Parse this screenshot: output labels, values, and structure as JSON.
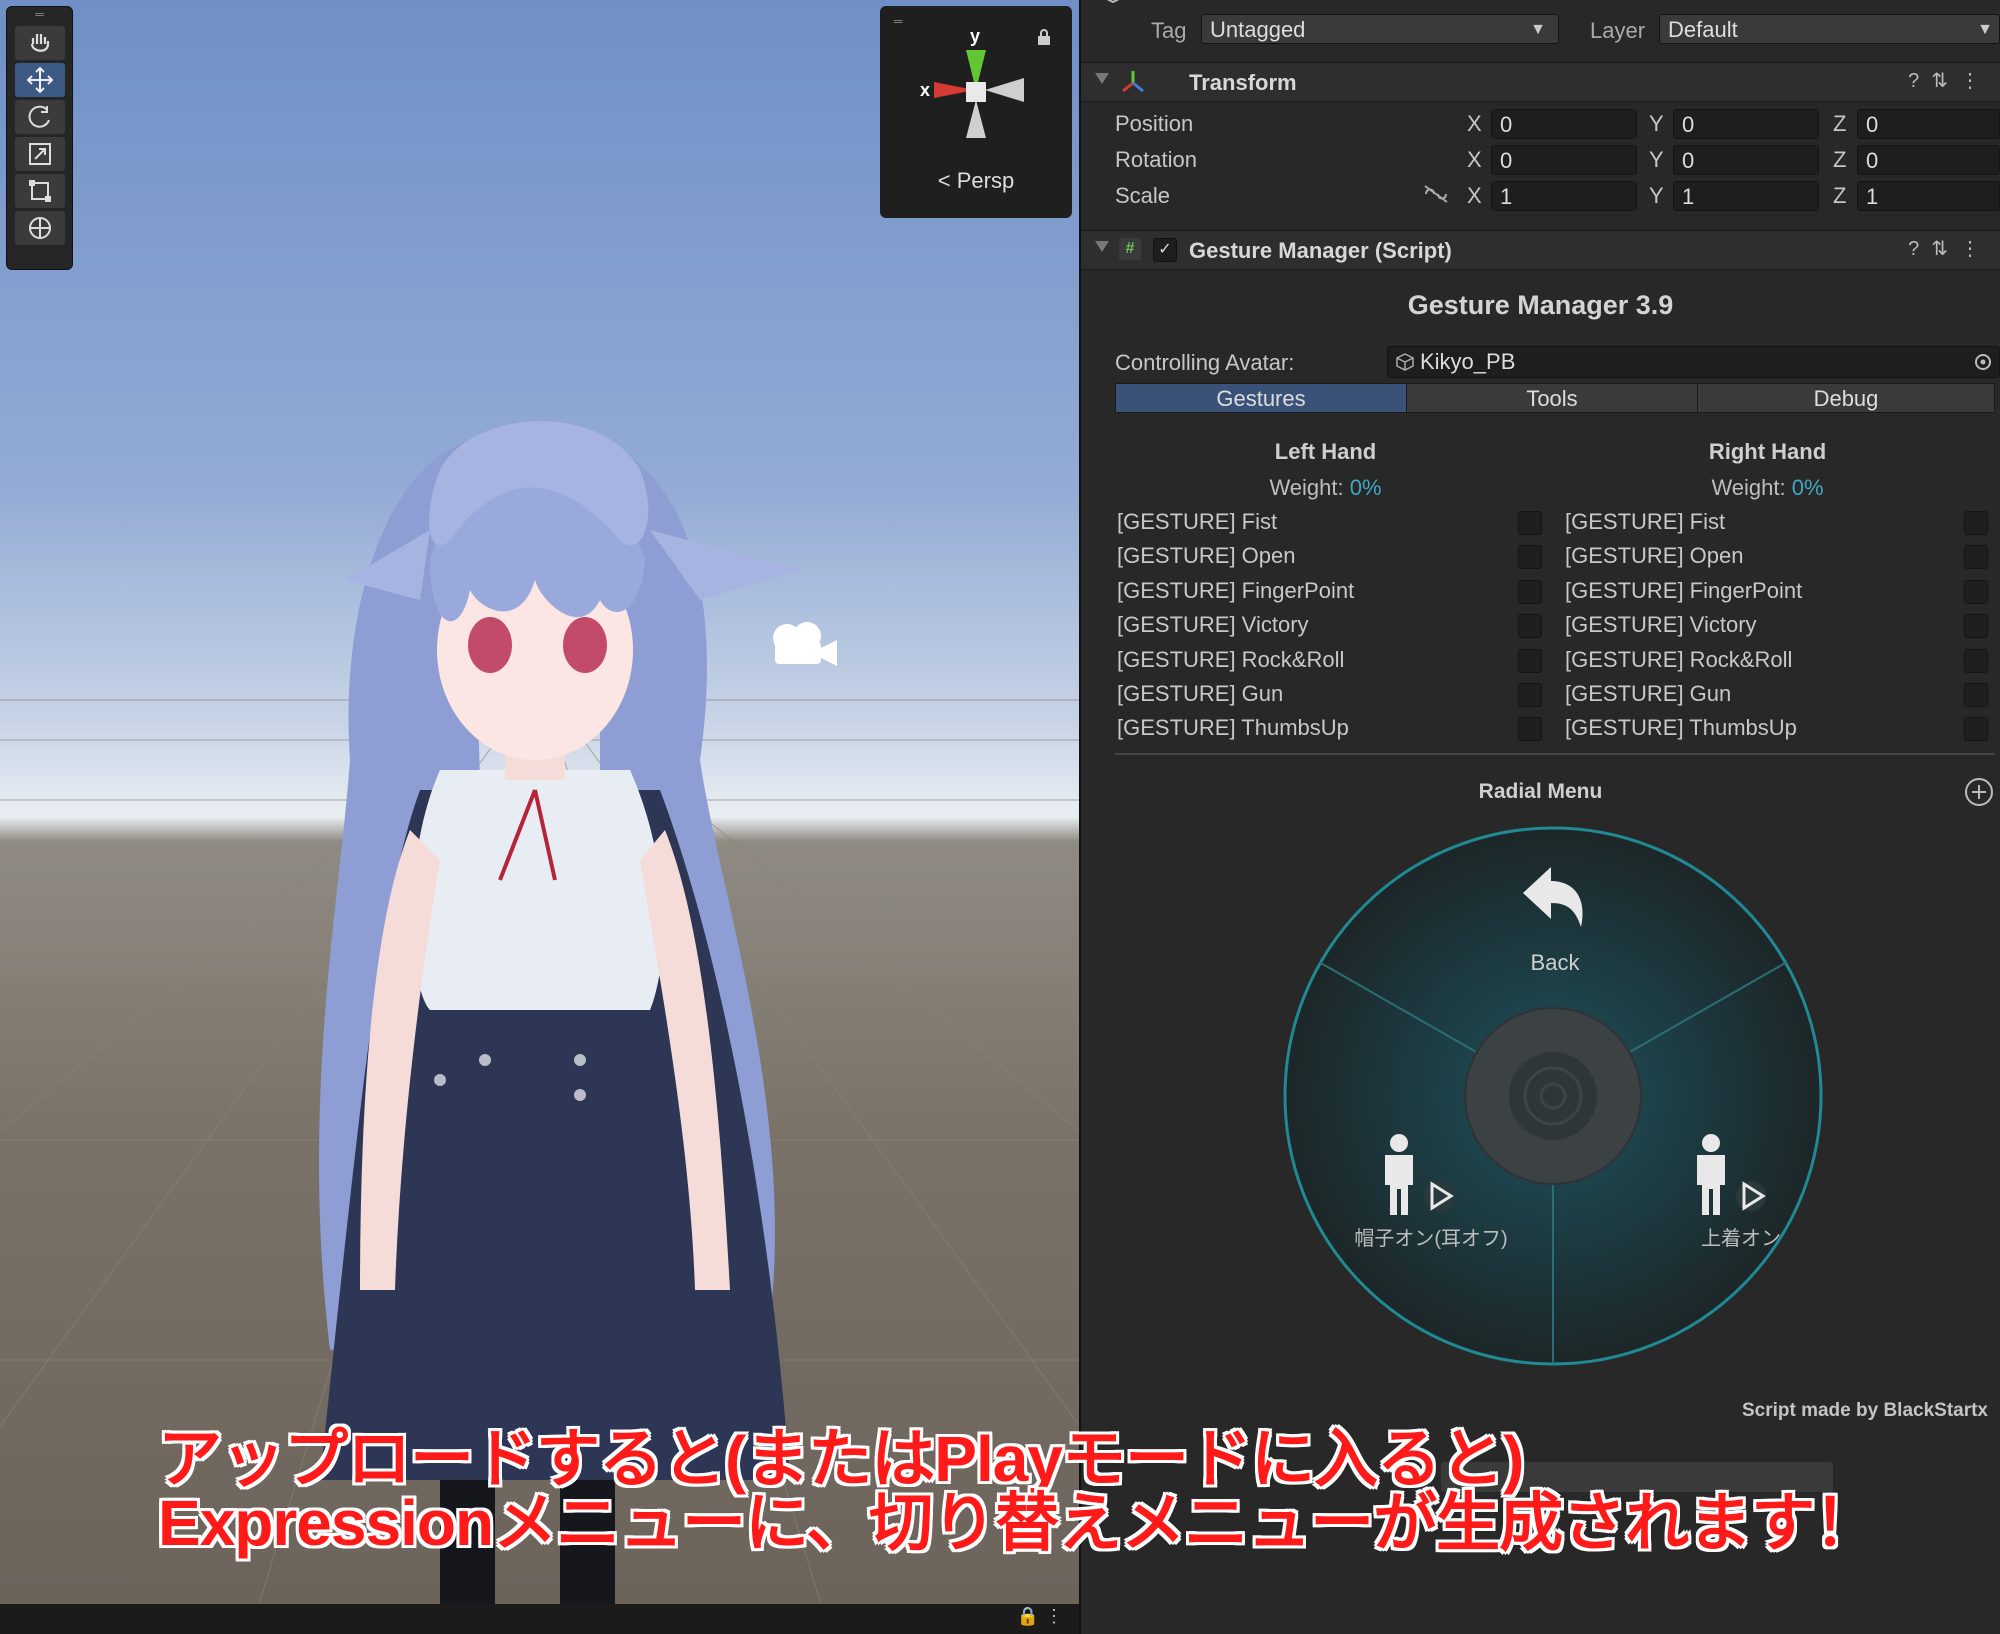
{
  "inspector": {
    "tag_label": "Tag",
    "tag_value": "Untagged",
    "layer_label": "Layer",
    "layer_value": "Default"
  },
  "transform": {
    "title": "Transform",
    "rows": [
      {
        "label": "Position",
        "x": "0",
        "y": "0",
        "z": "0"
      },
      {
        "label": "Rotation",
        "x": "0",
        "y": "0",
        "z": "0"
      },
      {
        "label": "Scale",
        "x": "1",
        "y": "1",
        "z": "1"
      }
    ],
    "axis_x": "X",
    "axis_y": "Y",
    "axis_z": "Z"
  },
  "gesture_manager": {
    "header": "Gesture Manager (Script)",
    "title": "Gesture Manager 3.9",
    "controlling_label": "Controlling Avatar:",
    "avatar": "Kikyo_PB",
    "tabs": [
      "Gestures",
      "Tools",
      "Debug"
    ],
    "active_tab": "Gestures",
    "left_title": "Left Hand",
    "right_title": "Right Hand",
    "weight_label": "Weight:",
    "left_weight": "0%",
    "right_weight": "0%",
    "gestures": [
      "[GESTURE] Fist",
      "[GESTURE] Open",
      "[GESTURE] FingerPoint",
      "[GESTURE] Victory",
      "[GESTURE] Rock&Roll",
      "[GESTURE] Gun",
      "[GESTURE] ThumbsUp"
    ],
    "radial_title": "Radial Menu",
    "radial_back": "Back",
    "radial_left": "帽子オン(耳オフ)",
    "radial_right": "上着オン",
    "credit": "Script made by BlackStartx"
  },
  "scene": {
    "gizmo_y": "y",
    "gizmo_x": "x",
    "persp": "Persp"
  },
  "caption": {
    "line1": "アップロードすると(またはPlayモードに入ると)",
    "line2": "Expressionメニューに、切り替えメニューが生成されます！"
  },
  "colors": {
    "accent": "#3a5278",
    "radial_ring": "#1f8a94",
    "weight": "#3ea7c4",
    "caption": "#ff1a1a"
  }
}
